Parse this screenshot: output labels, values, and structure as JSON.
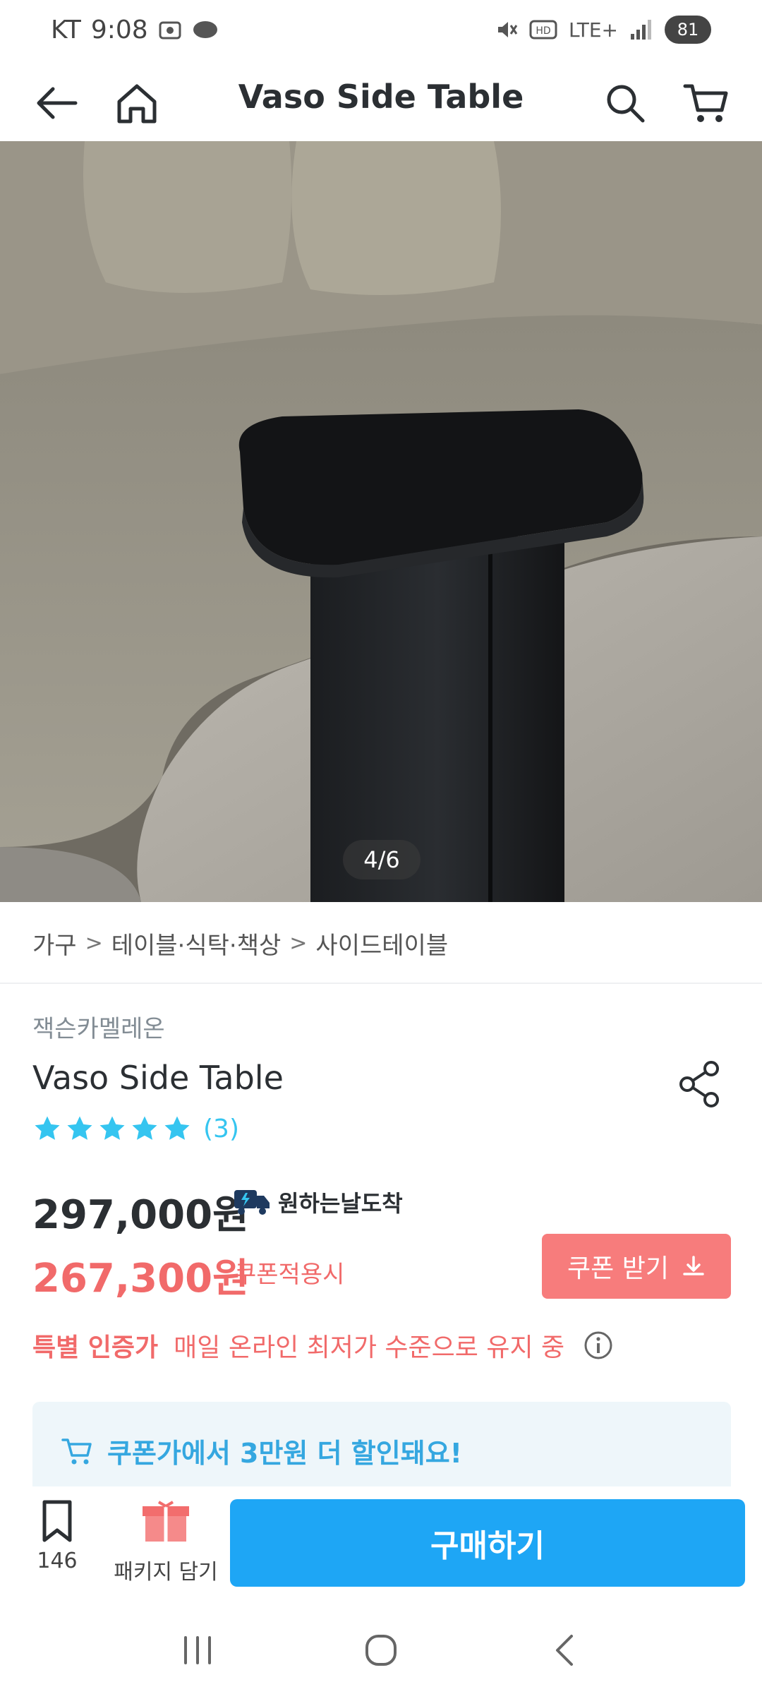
{
  "status_bar": {
    "carrier": "KT",
    "time": "9:08",
    "network": "LTE+",
    "battery": "81"
  },
  "header": {
    "title": "Vaso Side Table",
    "icons": [
      "back-arrow-icon",
      "home-icon",
      "search-icon",
      "cart-icon"
    ]
  },
  "hero": {
    "counter": "4/6",
    "current_index": 4,
    "total": 6
  },
  "breadcrumb": [
    "가구",
    "테이블·식탁·책상",
    "사이드테이블"
  ],
  "product": {
    "brand": "잭슨카멜레온",
    "name": "Vaso Side Table",
    "rating_stars": 5,
    "review_count": "(3)",
    "price_original": "297,000원",
    "delivery_label": "원하는날도착",
    "price_sale": "267,300원",
    "sale_note": "쿠폰적용시",
    "coupon_button": "쿠폰 받기",
    "special_label": "특별 인증가",
    "special_text": "매일 온라인 최저가 수준으로 유지 중",
    "promo_title": "쿠폰가에서 3만원 더 할인돼요!"
  },
  "action_bar": {
    "bookmark_count": "146",
    "package_label": "패키지 담기",
    "buy_button": "구매하기"
  },
  "colors": {
    "accent_blue": "#1ea6f5",
    "sale_red": "#f16a6a",
    "coupon_bg": "#f77c7c",
    "star_blue": "#35c5f0"
  }
}
